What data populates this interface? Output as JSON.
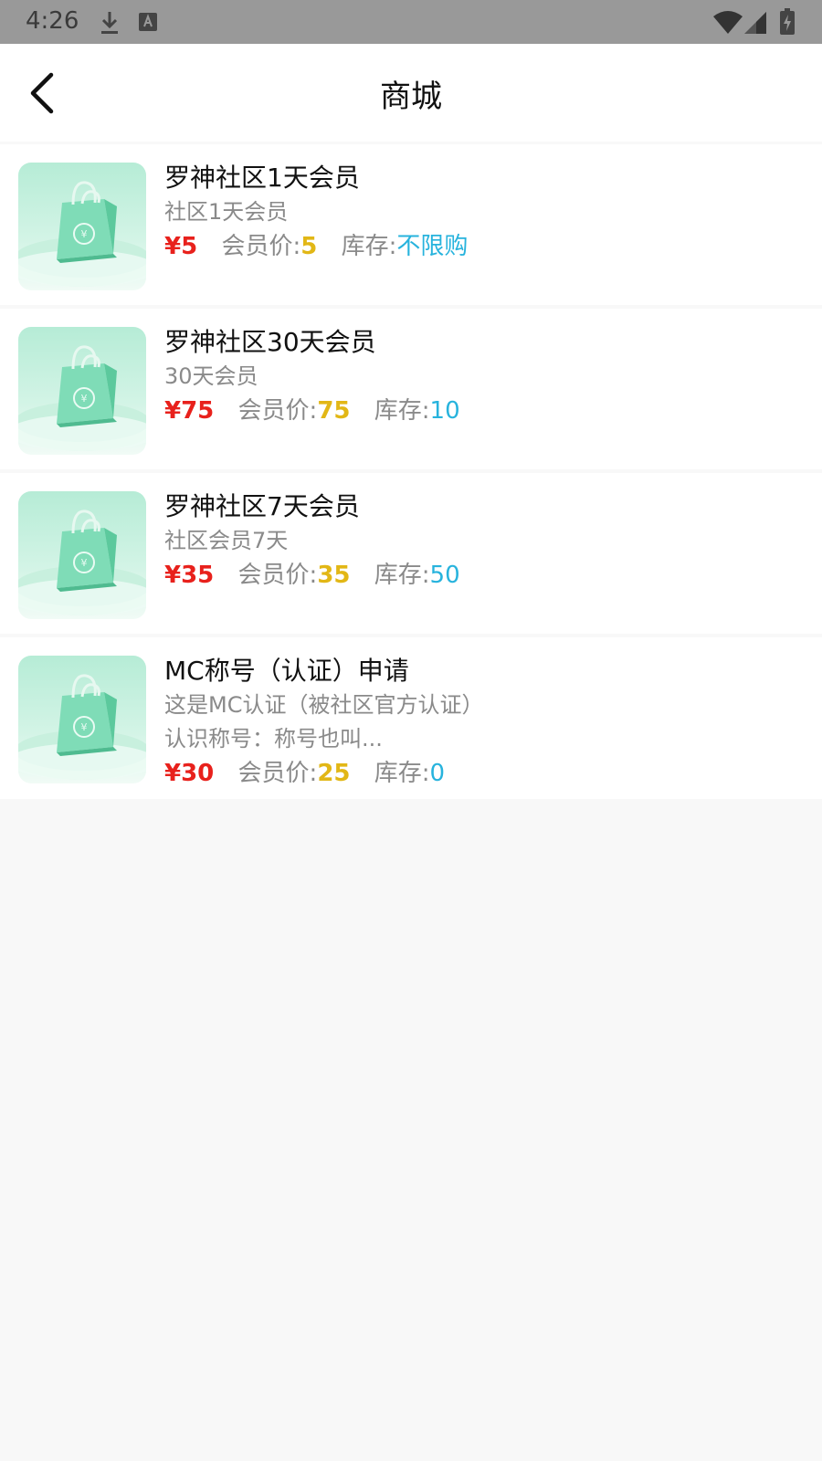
{
  "status_bar": {
    "time": "4:26",
    "icons": [
      "download-icon",
      "text-a-icon",
      "wifi-icon",
      "signal-icon",
      "battery-charging-icon"
    ]
  },
  "header": {
    "title": "商城",
    "back_icon": "chevron-left-icon"
  },
  "labels": {
    "member_price": "会员价:",
    "stock": "库存:"
  },
  "items": [
    {
      "title": "罗神社区1天会员",
      "desc": [
        "社区1天会员"
      ],
      "price": "¥5",
      "member_price": "5",
      "stock": "不限购"
    },
    {
      "title": "罗神社区30天会员",
      "desc": [
        "30天会员"
      ],
      "price": "¥75",
      "member_price": "75",
      "stock": "10"
    },
    {
      "title": "罗神社区7天会员",
      "desc": [
        "社区会员7天"
      ],
      "price": "¥35",
      "member_price": "35",
      "stock": "50"
    },
    {
      "title": "MC称号（认证）申请",
      "desc": [
        "这是MC认证（被社区官方认证）",
        "认识称号：称号也叫..."
      ],
      "price": "¥30",
      "member_price": "25",
      "stock": "0"
    }
  ],
  "colors": {
    "price": "#e8211c",
    "member_price": "#e2b716",
    "stock": "#27b3dd",
    "thumb": "#5fd3a6"
  }
}
